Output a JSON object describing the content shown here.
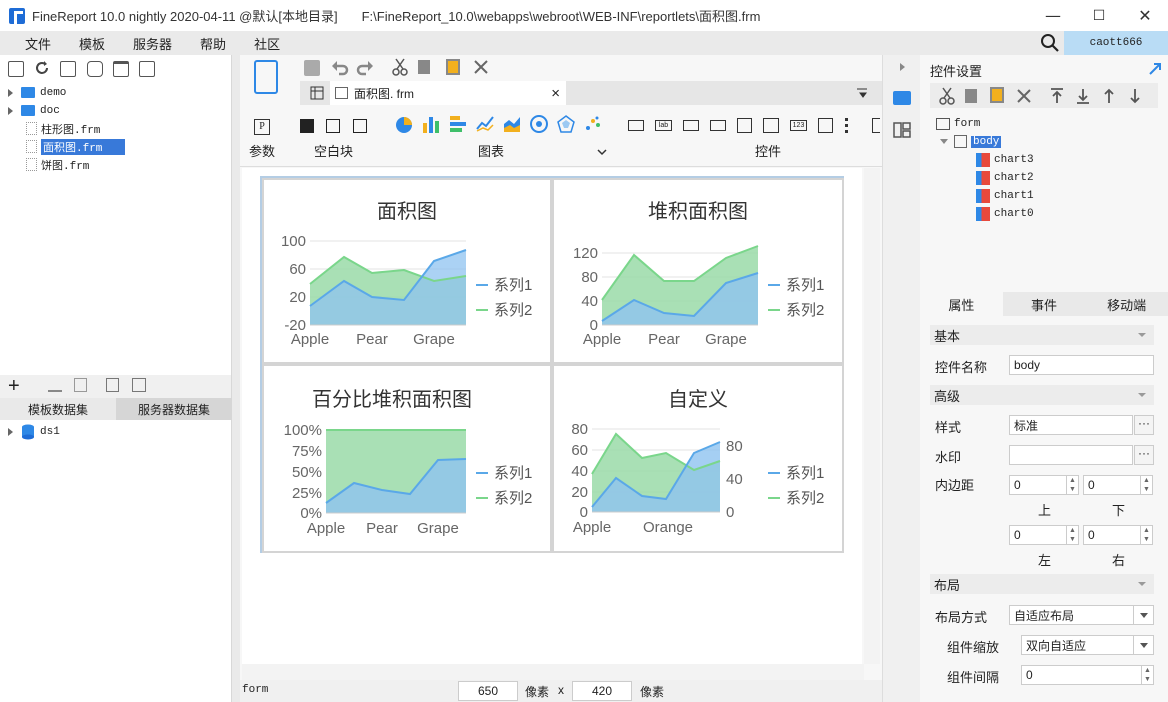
{
  "window": {
    "app_title": "FineReport 10.0 nightly 2020-04-11 @默认[本地目录]",
    "file_path": "F:\\FineReport_10.0\\webapps\\webroot\\WEB-INF\\reportlets\\面积图.frm",
    "minimize": "—",
    "maximize": "☐",
    "close": "✕"
  },
  "menu": [
    "文件",
    "模板",
    "服务器",
    "帮助",
    "社区"
  ],
  "user": "caott666",
  "file_tree": {
    "items": [
      {
        "label": "demo",
        "type": "folder"
      },
      {
        "label": "doc",
        "type": "folder"
      },
      {
        "label": "柱形图.frm",
        "type": "file"
      },
      {
        "label": "面积图.frm",
        "type": "file",
        "selected": true
      },
      {
        "label": "饼图.frm",
        "type": "file"
      }
    ]
  },
  "dataset_tabs": [
    "模板数据集",
    "服务器数据集"
  ],
  "dataset_items": [
    "ds1"
  ],
  "doc_tab": {
    "label": "面积图. frm",
    "close": "×"
  },
  "widget_groups": {
    "param": "参数",
    "blank": "空白块",
    "chart": "图表",
    "widget": "控件"
  },
  "charts": {
    "series_names": [
      "系列1",
      "系列2"
    ],
    "chart0": {
      "title": "面积图",
      "y_ticks": [
        "100",
        "60",
        "20",
        "-20"
      ],
      "x_ticks": [
        "Apple",
        "Pear",
        "Grape"
      ]
    },
    "chart1": {
      "title": "堆积面积图",
      "y_ticks": [
        "120",
        "80",
        "40",
        "0"
      ],
      "x_ticks": [
        "Apple",
        "Pear",
        "Grape"
      ]
    },
    "chart2": {
      "title": "百分比堆积面积图",
      "y_ticks": [
        "100%",
        "75%",
        "50%",
        "25%",
        "0%"
      ],
      "x_ticks": [
        "Apple",
        "Pear",
        "Grape"
      ]
    },
    "chart3": {
      "title": "自定义",
      "y_ticks": [
        "80",
        "60",
        "40",
        "20",
        "0"
      ],
      "y2_ticks": [
        "80",
        "40",
        "0"
      ],
      "x_ticks": [
        "Apple",
        "Orange"
      ]
    }
  },
  "statusbar": {
    "form": "form",
    "width": "650",
    "unit1": "像素",
    "x": "x",
    "height": "420",
    "unit2": "像素"
  },
  "right_panel": {
    "title": "控件设置",
    "tree": [
      "form",
      "body",
      "chart3",
      "chart2",
      "chart1",
      "chart0"
    ],
    "prop_tabs": [
      "属性",
      "事件",
      "移动端"
    ],
    "sections": {
      "basic": "基本",
      "advanced": "高级",
      "layout": "布局"
    },
    "labels": {
      "widget_name": "控件名称",
      "style": "样式",
      "watermark": "水印",
      "padding": "内边距",
      "top": "上",
      "bottom": "下",
      "left": "左",
      "right": "右",
      "layout_mode": "布局方式",
      "scale": "组件缩放",
      "gap": "组件间隔"
    },
    "values": {
      "widget_name": "body",
      "style": "标准",
      "watermark": "",
      "pad_top": "0",
      "pad_bottom": "0",
      "pad_left": "0",
      "pad_right": "0",
      "layout_mode": "自适应布局",
      "scale": "双向自适应",
      "gap": "0",
      "ellipsis": "···"
    }
  }
}
